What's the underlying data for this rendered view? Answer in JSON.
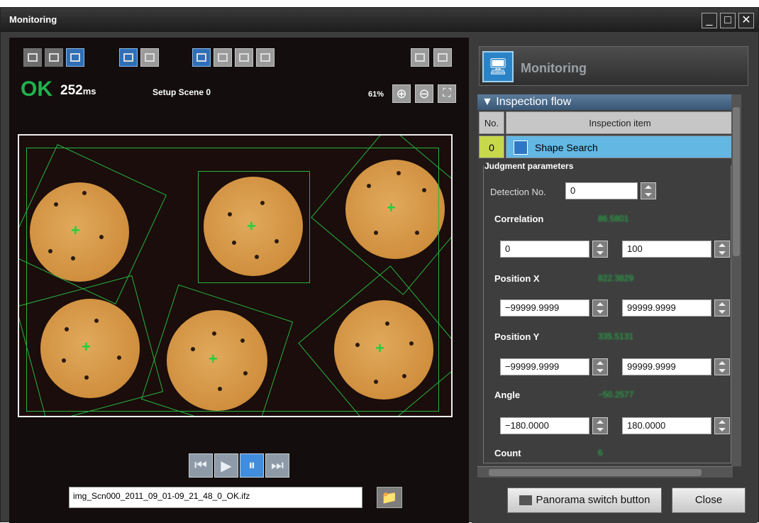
{
  "window": {
    "title": "Monitoring",
    "minimize": "_",
    "maximize": "□",
    "close": "✕"
  },
  "status": {
    "result": "OK",
    "time_value": "252",
    "time_unit": "ms",
    "scene": "Setup Scene 0",
    "zoom": "61%"
  },
  "file": {
    "name": "img_Scn000_2011_09_01-09_21_48_0_OK.ifz"
  },
  "monitor_panel": {
    "title": "Monitoring",
    "flow_title": "Inspection flow",
    "col_no": "No.",
    "col_item": "Inspection item",
    "row_no": "0",
    "row_item": "Shape Search",
    "judgment_title": "Judgment parameters",
    "detection_label": "Detection No.",
    "detection_value": "0",
    "params": [
      {
        "label": "Correlation",
        "value": "86.5801",
        "min": "0",
        "max": "100"
      },
      {
        "label": "Position X",
        "value": "822.3829",
        "min": "−99999.9999",
        "max": "99999.9999"
      },
      {
        "label": "Position Y",
        "value": "335.5131",
        "min": "−99999.9999",
        "max": "99999.9999"
      },
      {
        "label": "Angle",
        "value": "−50.2577",
        "min": "−180.0000",
        "max": "180.0000"
      },
      {
        "label": "Count",
        "value": "6"
      }
    ]
  },
  "buttons": {
    "panorama": "Panorama switch button",
    "close": "Close"
  },
  "icons": [
    "monitor-icon",
    "shape-search-icon",
    "folder-icon",
    "zoom-in-icon",
    "zoom-out-icon",
    "fit-icon",
    "grid-icon",
    "first-frame-icon",
    "play-icon",
    "pause-icon",
    "last-frame-icon"
  ]
}
